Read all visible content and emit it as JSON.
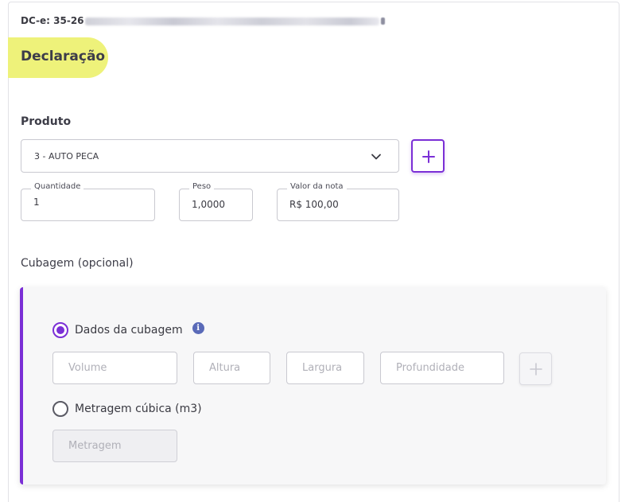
{
  "document": {
    "id_prefix": "DC-e: 35-26",
    "title": "Declaração"
  },
  "produto": {
    "section_label": "Produto",
    "selected": "3 - AUTO PECA",
    "fields": {
      "quantidade": {
        "label": "Quantidade",
        "value": "1"
      },
      "peso": {
        "label": "Peso",
        "value": "1,0000"
      },
      "valor": {
        "label": "Valor da nota",
        "value": "R$ 100,00"
      }
    }
  },
  "cubagem": {
    "section_label": "Cubagem (opcional)",
    "option_dados": "Dados da cubagem",
    "option_metragem": "Metragem cúbica (m3)",
    "placeholders": {
      "volume": "Volume",
      "altura": "Altura",
      "largura": "Largura",
      "profundidade": "Profundidade",
      "metragem": "Metragem"
    },
    "info_glyph": "i"
  },
  "colors": {
    "accent": "#7b2fd6",
    "highlight": "#eef27a",
    "info": "#5a6ab8"
  },
  "icons": {
    "select_chevron": "chevron-down-icon",
    "add": "plus-icon",
    "info": "info-icon"
  }
}
